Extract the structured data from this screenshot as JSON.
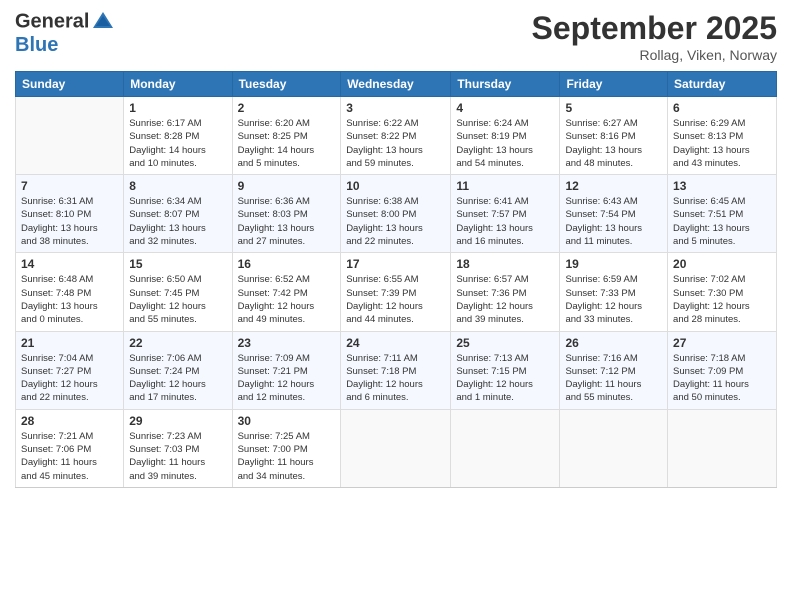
{
  "header": {
    "logo_line1": "General",
    "logo_line2": "Blue",
    "month": "September 2025",
    "location": "Rollag, Viken, Norway"
  },
  "weekdays": [
    "Sunday",
    "Monday",
    "Tuesday",
    "Wednesday",
    "Thursday",
    "Friday",
    "Saturday"
  ],
  "weeks": [
    [
      {
        "day": "",
        "sunrise": "",
        "sunset": "",
        "daylight": ""
      },
      {
        "day": "1",
        "sunrise": "Sunrise: 6:17 AM",
        "sunset": "Sunset: 8:28 PM",
        "daylight": "Daylight: 14 hours and 10 minutes."
      },
      {
        "day": "2",
        "sunrise": "Sunrise: 6:20 AM",
        "sunset": "Sunset: 8:25 PM",
        "daylight": "Daylight: 14 hours and 5 minutes."
      },
      {
        "day": "3",
        "sunrise": "Sunrise: 6:22 AM",
        "sunset": "Sunset: 8:22 PM",
        "daylight": "Daylight: 13 hours and 59 minutes."
      },
      {
        "day": "4",
        "sunrise": "Sunrise: 6:24 AM",
        "sunset": "Sunset: 8:19 PM",
        "daylight": "Daylight: 13 hours and 54 minutes."
      },
      {
        "day": "5",
        "sunrise": "Sunrise: 6:27 AM",
        "sunset": "Sunset: 8:16 PM",
        "daylight": "Daylight: 13 hours and 48 minutes."
      },
      {
        "day": "6",
        "sunrise": "Sunrise: 6:29 AM",
        "sunset": "Sunset: 8:13 PM",
        "daylight": "Daylight: 13 hours and 43 minutes."
      }
    ],
    [
      {
        "day": "7",
        "sunrise": "Sunrise: 6:31 AM",
        "sunset": "Sunset: 8:10 PM",
        "daylight": "Daylight: 13 hours and 38 minutes."
      },
      {
        "day": "8",
        "sunrise": "Sunrise: 6:34 AM",
        "sunset": "Sunset: 8:07 PM",
        "daylight": "Daylight: 13 hours and 32 minutes."
      },
      {
        "day": "9",
        "sunrise": "Sunrise: 6:36 AM",
        "sunset": "Sunset: 8:03 PM",
        "daylight": "Daylight: 13 hours and 27 minutes."
      },
      {
        "day": "10",
        "sunrise": "Sunrise: 6:38 AM",
        "sunset": "Sunset: 8:00 PM",
        "daylight": "Daylight: 13 hours and 22 minutes."
      },
      {
        "day": "11",
        "sunrise": "Sunrise: 6:41 AM",
        "sunset": "Sunset: 7:57 PM",
        "daylight": "Daylight: 13 hours and 16 minutes."
      },
      {
        "day": "12",
        "sunrise": "Sunrise: 6:43 AM",
        "sunset": "Sunset: 7:54 PM",
        "daylight": "Daylight: 13 hours and 11 minutes."
      },
      {
        "day": "13",
        "sunrise": "Sunrise: 6:45 AM",
        "sunset": "Sunset: 7:51 PM",
        "daylight": "Daylight: 13 hours and 5 minutes."
      }
    ],
    [
      {
        "day": "14",
        "sunrise": "Sunrise: 6:48 AM",
        "sunset": "Sunset: 7:48 PM",
        "daylight": "Daylight: 13 hours and 0 minutes."
      },
      {
        "day": "15",
        "sunrise": "Sunrise: 6:50 AM",
        "sunset": "Sunset: 7:45 PM",
        "daylight": "Daylight: 12 hours and 55 minutes."
      },
      {
        "day": "16",
        "sunrise": "Sunrise: 6:52 AM",
        "sunset": "Sunset: 7:42 PM",
        "daylight": "Daylight: 12 hours and 49 minutes."
      },
      {
        "day": "17",
        "sunrise": "Sunrise: 6:55 AM",
        "sunset": "Sunset: 7:39 PM",
        "daylight": "Daylight: 12 hours and 44 minutes."
      },
      {
        "day": "18",
        "sunrise": "Sunrise: 6:57 AM",
        "sunset": "Sunset: 7:36 PM",
        "daylight": "Daylight: 12 hours and 39 minutes."
      },
      {
        "day": "19",
        "sunrise": "Sunrise: 6:59 AM",
        "sunset": "Sunset: 7:33 PM",
        "daylight": "Daylight: 12 hours and 33 minutes."
      },
      {
        "day": "20",
        "sunrise": "Sunrise: 7:02 AM",
        "sunset": "Sunset: 7:30 PM",
        "daylight": "Daylight: 12 hours and 28 minutes."
      }
    ],
    [
      {
        "day": "21",
        "sunrise": "Sunrise: 7:04 AM",
        "sunset": "Sunset: 7:27 PM",
        "daylight": "Daylight: 12 hours and 22 minutes."
      },
      {
        "day": "22",
        "sunrise": "Sunrise: 7:06 AM",
        "sunset": "Sunset: 7:24 PM",
        "daylight": "Daylight: 12 hours and 17 minutes."
      },
      {
        "day": "23",
        "sunrise": "Sunrise: 7:09 AM",
        "sunset": "Sunset: 7:21 PM",
        "daylight": "Daylight: 12 hours and 12 minutes."
      },
      {
        "day": "24",
        "sunrise": "Sunrise: 7:11 AM",
        "sunset": "Sunset: 7:18 PM",
        "daylight": "Daylight: 12 hours and 6 minutes."
      },
      {
        "day": "25",
        "sunrise": "Sunrise: 7:13 AM",
        "sunset": "Sunset: 7:15 PM",
        "daylight": "Daylight: 12 hours and 1 minute."
      },
      {
        "day": "26",
        "sunrise": "Sunrise: 7:16 AM",
        "sunset": "Sunset: 7:12 PM",
        "daylight": "Daylight: 11 hours and 55 minutes."
      },
      {
        "day": "27",
        "sunrise": "Sunrise: 7:18 AM",
        "sunset": "Sunset: 7:09 PM",
        "daylight": "Daylight: 11 hours and 50 minutes."
      }
    ],
    [
      {
        "day": "28",
        "sunrise": "Sunrise: 7:21 AM",
        "sunset": "Sunset: 7:06 PM",
        "daylight": "Daylight: 11 hours and 45 minutes."
      },
      {
        "day": "29",
        "sunrise": "Sunrise: 7:23 AM",
        "sunset": "Sunset: 7:03 PM",
        "daylight": "Daylight: 11 hours and 39 minutes."
      },
      {
        "day": "30",
        "sunrise": "Sunrise: 7:25 AM",
        "sunset": "Sunset: 7:00 PM",
        "daylight": "Daylight: 11 hours and 34 minutes."
      },
      {
        "day": "",
        "sunrise": "",
        "sunset": "",
        "daylight": ""
      },
      {
        "day": "",
        "sunrise": "",
        "sunset": "",
        "daylight": ""
      },
      {
        "day": "",
        "sunrise": "",
        "sunset": "",
        "daylight": ""
      },
      {
        "day": "",
        "sunrise": "",
        "sunset": "",
        "daylight": ""
      }
    ]
  ]
}
